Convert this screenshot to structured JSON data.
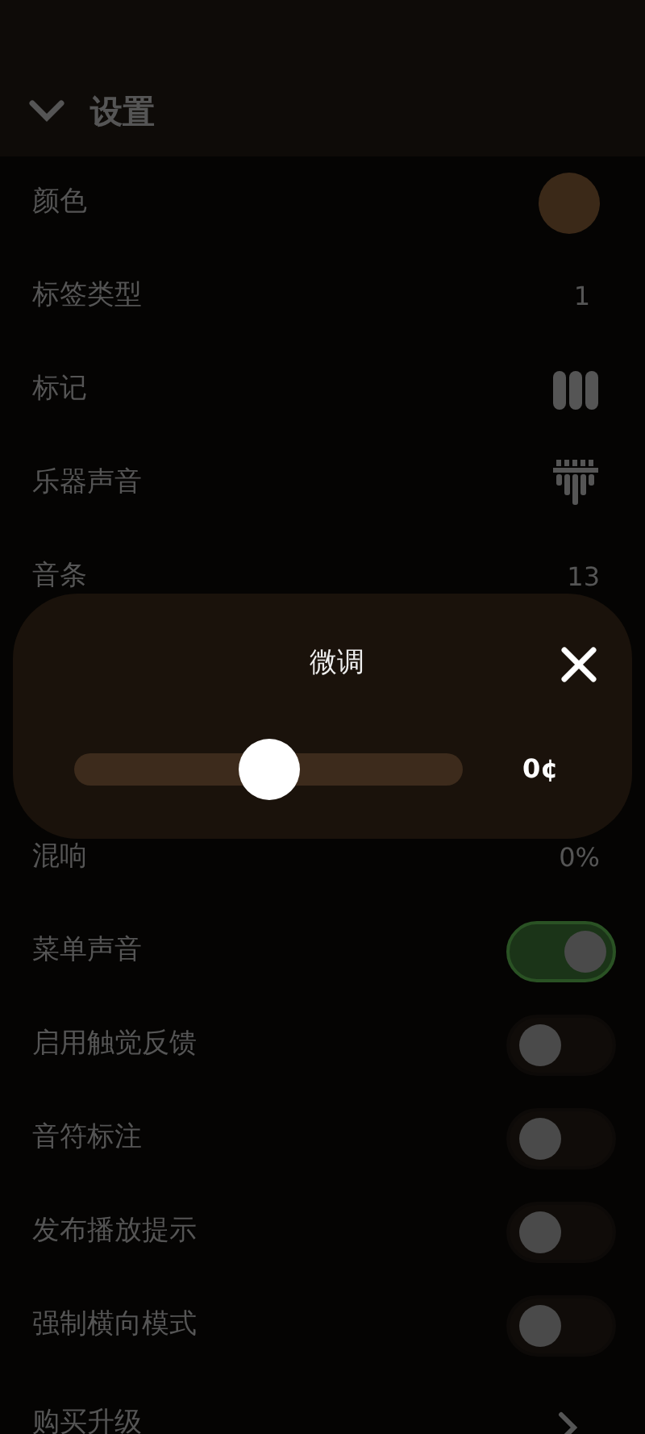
{
  "header": {
    "title": "设置",
    "expanded": true
  },
  "rows": [
    {
      "label": "颜色",
      "kind": "swatch",
      "color": "#3b2918"
    },
    {
      "label": "标签类型",
      "kind": "value",
      "value": "1"
    },
    {
      "label": "标记",
      "kind": "bars"
    },
    {
      "label": "乐器声音",
      "kind": "tines"
    },
    {
      "label": "音条",
      "kind": "value",
      "value": "13"
    },
    {
      "kind": "hidden"
    },
    {
      "label": "混响",
      "kind": "value",
      "value": "0%"
    },
    {
      "label": "菜单声音",
      "kind": "toggle",
      "on": true
    },
    {
      "label": "启用触觉反馈",
      "kind": "toggle",
      "on": false
    },
    {
      "label": "音符标注",
      "kind": "toggle",
      "on": false
    },
    {
      "label": "发布播放提示",
      "kind": "toggle",
      "on": false
    },
    {
      "label": "强制横向模式",
      "kind": "toggle",
      "on": false
    },
    {
      "label": "购买升级",
      "kind": "nav"
    }
  ],
  "dialog": {
    "title": "微调",
    "level": 0.5,
    "reading": "0¢"
  }
}
